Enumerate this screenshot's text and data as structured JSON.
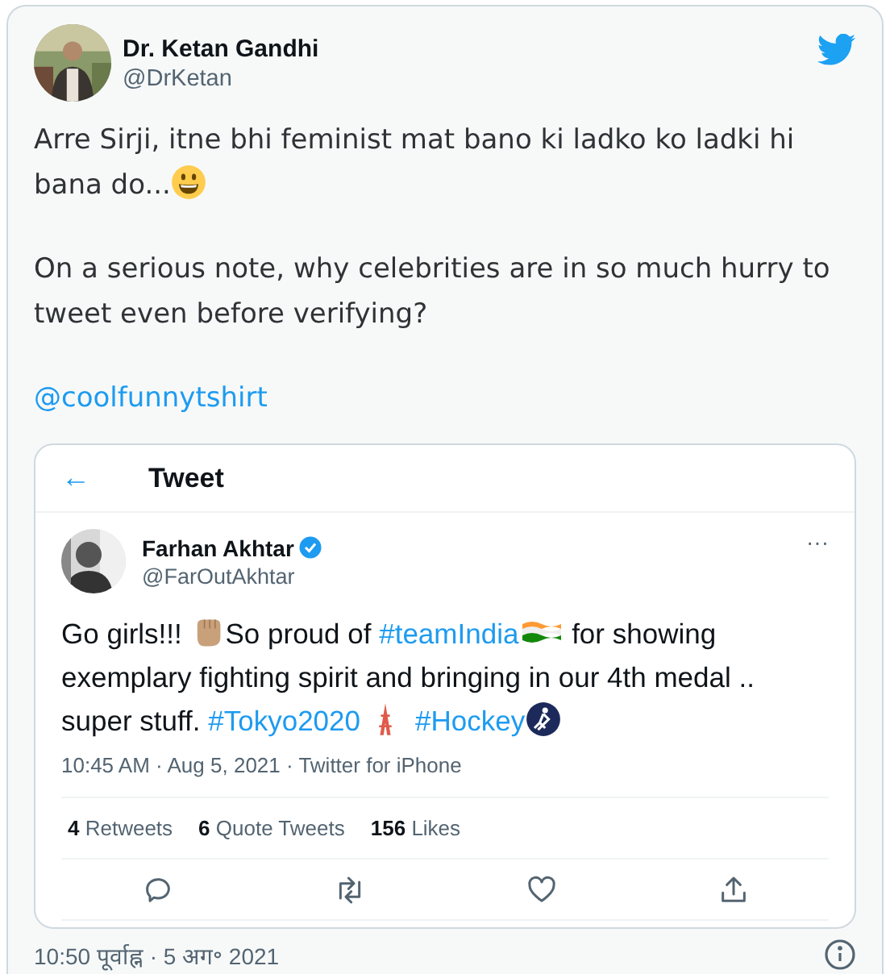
{
  "author": {
    "name": "Dr. Ketan Gandhi",
    "handle": "@DrKetan"
  },
  "body": [
    {
      "kind": "paragraph",
      "segments": [
        {
          "kind": "text",
          "text": "Arre Sirji, itne bhi feminist mat bano ki ladko ko ladki hi bana do..."
        },
        {
          "kind": "smiley"
        }
      ]
    },
    {
      "kind": "paragraph",
      "segments": [
        {
          "kind": "text",
          "text": "On a serious note, why celebrities are in so much hurry to tweet even before verifying?"
        }
      ]
    },
    {
      "kind": "paragraph",
      "segments": [
        {
          "kind": "mention",
          "text": "@coolfunnytshirt"
        }
      ]
    }
  ],
  "screenshot": {
    "header": {
      "back": "←",
      "title": "Tweet"
    },
    "author": {
      "name": "Farhan Akhtar",
      "verified": true,
      "handle": "@FarOutAkhtar"
    },
    "more": "···",
    "body": [
      {
        "kind": "text",
        "text": "Go girls!!! "
      },
      {
        "kind": "fist"
      },
      {
        "kind": "text",
        "text": "So proud of "
      },
      {
        "kind": "hashtag",
        "text": "#teamIndia"
      },
      {
        "kind": "flag"
      },
      {
        "kind": "text",
        "text": "  for showing exemplary fighting spirit and bringing in our 4th medal .. super stuff. "
      },
      {
        "kind": "hashtag",
        "text": "#Tokyo2020"
      },
      {
        "kind": "tower"
      },
      {
        "kind": "hashtag",
        "text": "#Hockey"
      },
      {
        "kind": "hockey"
      }
    ],
    "meta": "10:45 AM · Aug 5, 2021 · Twitter for iPhone",
    "stats": [
      {
        "count": "4",
        "label": "Retweets"
      },
      {
        "count": "6",
        "label": "Quote Tweets"
      },
      {
        "count": "156",
        "label": "Likes"
      }
    ],
    "actions": [
      {
        "kind": "reply"
      },
      {
        "kind": "retweet"
      },
      {
        "kind": "like"
      },
      {
        "kind": "share"
      }
    ]
  },
  "footer": {
    "time": "10:50 पूर्वाह्न · 5 अग॰ 2021"
  }
}
